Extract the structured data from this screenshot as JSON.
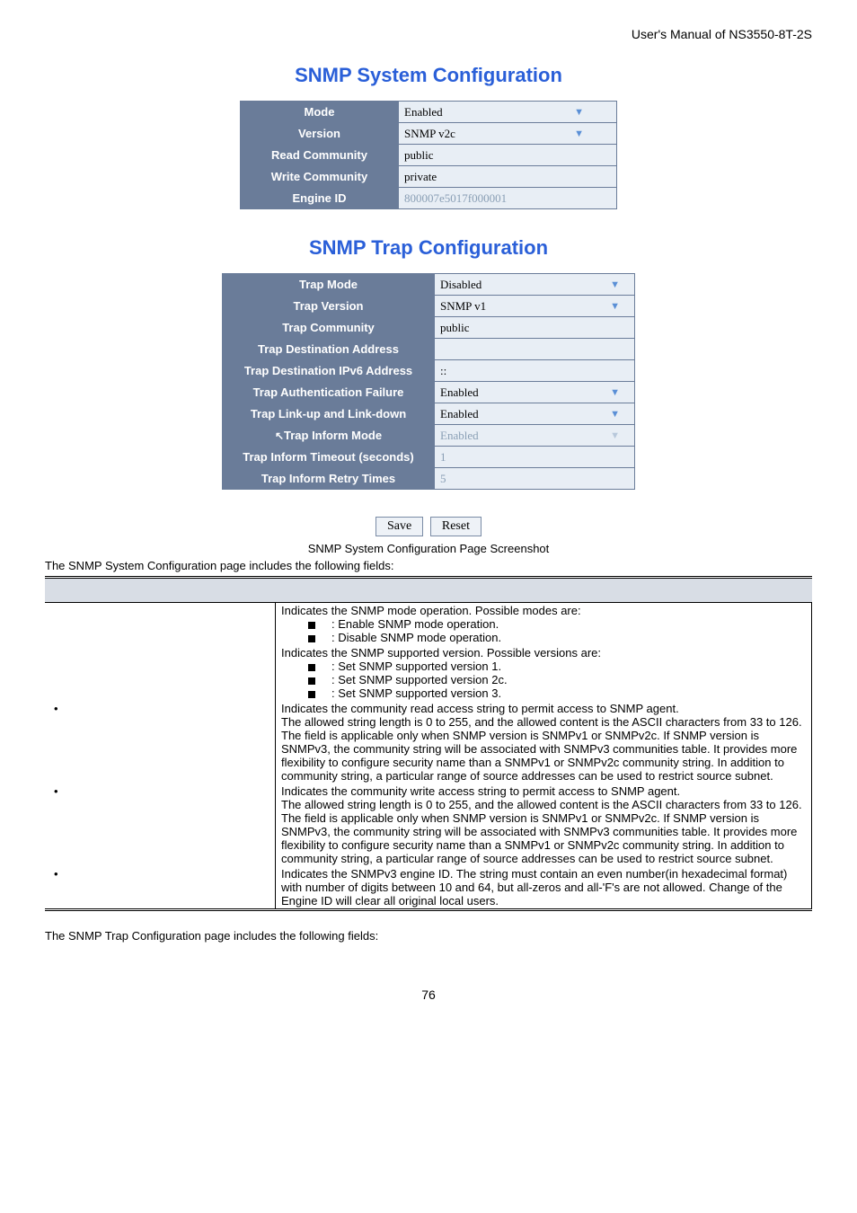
{
  "header": {
    "right": "User's Manual of NS3550-8T-2S"
  },
  "section1": {
    "title": "SNMP System Configuration",
    "rows": [
      {
        "label": "Mode",
        "value": "Enabled",
        "type": "dropdown"
      },
      {
        "label": "Version",
        "value": "SNMP v2c",
        "type": "dropdown"
      },
      {
        "label": "Read Community",
        "value": "public",
        "type": "text"
      },
      {
        "label": "Write Community",
        "value": "private",
        "type": "text"
      },
      {
        "label": "Engine ID",
        "value": "800007e5017f000001",
        "type": "text",
        "disabled": true
      }
    ]
  },
  "section2": {
    "title": "SNMP Trap Configuration",
    "rows": [
      {
        "label": "Trap Mode",
        "value": "Disabled",
        "type": "dropdown"
      },
      {
        "label": "Trap Version",
        "value": "SNMP v1",
        "type": "dropdown"
      },
      {
        "label": "Trap Community",
        "value": "public",
        "type": "text"
      },
      {
        "label": "Trap Destination Address",
        "value": "",
        "type": "text"
      },
      {
        "label": "Trap Destination IPv6 Address",
        "value": "::",
        "type": "text"
      },
      {
        "label": "Trap Authentication Failure",
        "value": "Enabled",
        "type": "dropdown"
      },
      {
        "label": "Trap Link-up and Link-down",
        "value": "Enabled",
        "type": "dropdown"
      },
      {
        "label": "Trap Inform Mode",
        "value": "Enabled",
        "type": "dropdown",
        "disabled": true,
        "cursor": true
      },
      {
        "label": "Trap Inform Timeout (seconds)",
        "value": "1",
        "type": "text",
        "disabled": true
      },
      {
        "label": "Trap Inform Retry Times",
        "value": "5",
        "type": "text",
        "disabled": true
      }
    ]
  },
  "buttons": {
    "save": "Save",
    "reset": "Reset"
  },
  "caption1": "SNMP System Configuration Page Screenshot",
  "intro1": "The SNMP System Configuration page includes the following fields:",
  "fields": [
    {
      "label": "",
      "desc_lines": [
        "Indicates the SNMP mode operation. Possible modes are:"
      ],
      "bullets": [
        ": Enable SNMP mode operation.",
        ": Disable SNMP mode operation."
      ]
    },
    {
      "label": "",
      "desc_lines": [
        "Indicates the SNMP supported version. Possible versions are:"
      ],
      "bullets": [
        ": Set SNMP supported version 1.",
        ": Set SNMP supported version 2c.",
        ": Set SNMP supported version 3."
      ]
    },
    {
      "label": "",
      "bulleted_label": true,
      "desc_lines": [
        "Indicates the community read access string to permit access to SNMP agent.",
        "The allowed string length is 0 to 255, and the allowed content is the ASCII characters from 33 to 126.",
        "The field is applicable only when SNMP version is SNMPv1 or SNMPv2c. If SNMP version is SNMPv3, the community string will be associated with SNMPv3 communities table. It provides more flexibility to configure security name than a SNMPv1 or SNMPv2c community string. In addition to community string, a particular range of source addresses can be used to restrict source subnet."
      ]
    },
    {
      "label": "",
      "bulleted_label": true,
      "desc_lines": [
        "Indicates the community write access string to permit access to SNMP agent.",
        "The allowed string length is 0 to 255, and the allowed content is the ASCII characters from 33 to 126.",
        "The field is applicable only when SNMP version is SNMPv1 or SNMPv2c. If SNMP version is SNMPv3, the community string will be associated with SNMPv3 communities table. It provides more flexibility to configure security name than a SNMPv1 or SNMPv2c community string. In addition to community string, a particular range of source addresses can be used to restrict source subnet."
      ]
    },
    {
      "label": "",
      "bulleted_label": true,
      "desc_lines": [
        "Indicates the SNMPv3 engine ID. The string must contain an even number(in hexadecimal format) with number of digits between 10 and 64, but all-zeros and all-'F's are not allowed. Change of the Engine ID will clear all original local users."
      ]
    }
  ],
  "intro2": "The SNMP Trap Configuration page includes the following fields:",
  "page_number": "76"
}
